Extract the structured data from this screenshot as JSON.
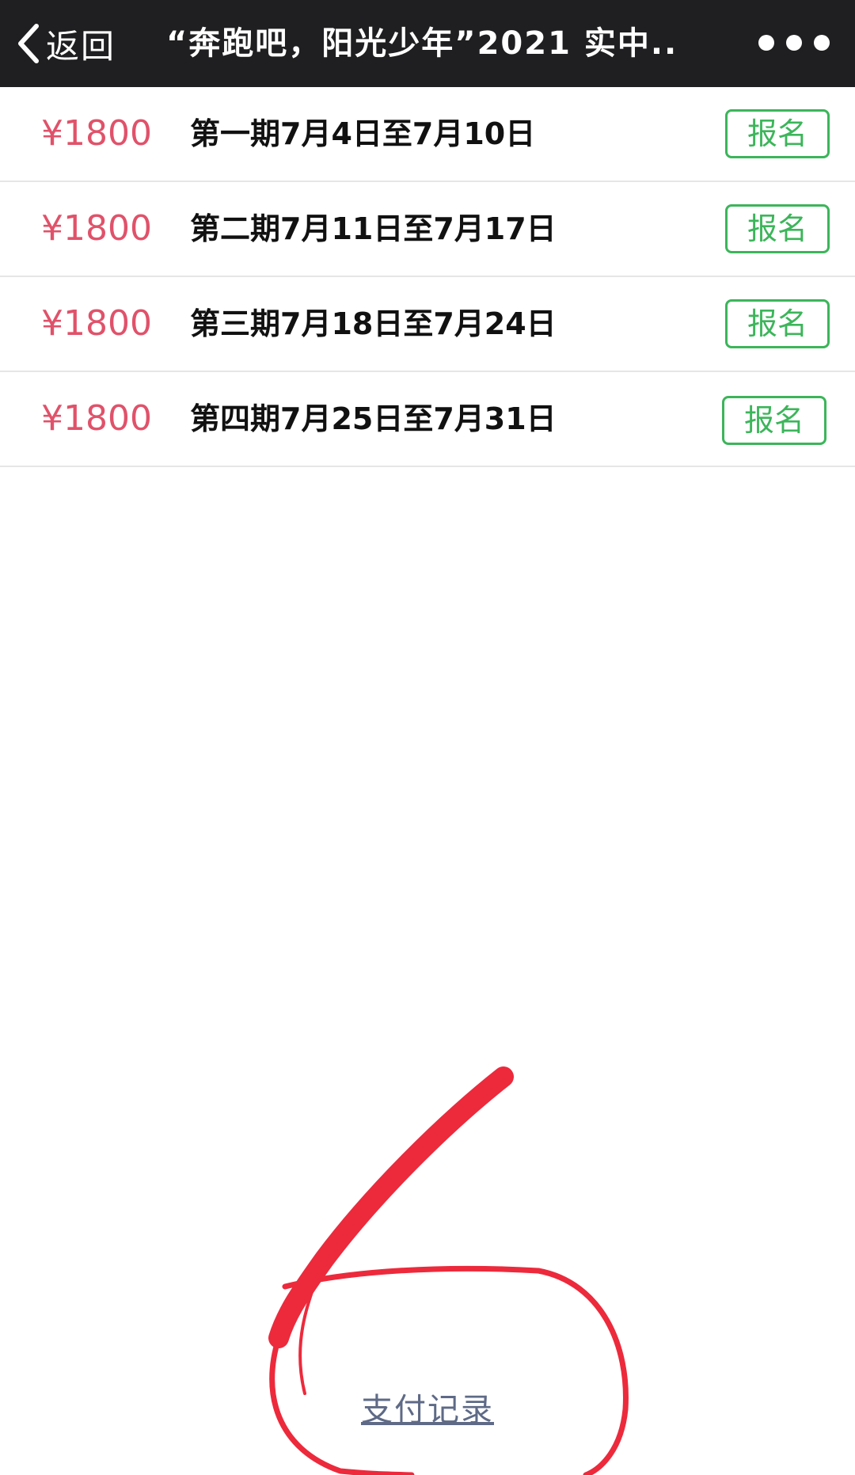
{
  "header": {
    "back_label": "返回",
    "title": "“奔跑吧，阳光少年”2021 实中..",
    "more_icon": "more-dots-icon"
  },
  "sessions": [
    {
      "price": "¥1800",
      "period": "第一期7月4日至7月10日",
      "button": "报名"
    },
    {
      "price": "¥1800",
      "period": "第二期7月11日至7月17日",
      "button": "报名"
    },
    {
      "price": "¥1800",
      "period": "第三期7月18日至7月24日",
      "button": "报名"
    },
    {
      "price": "¥1800",
      "period": "第四期7月25日至7月31日",
      "button": "报名"
    }
  ],
  "footer": {
    "pay_record_label": "支付记录"
  },
  "colors": {
    "topbar": "#1f1f21",
    "price": "#e0526a",
    "signup": "#3cb55a",
    "annotation": "#ec2a3c",
    "link": "#5e6a86"
  }
}
